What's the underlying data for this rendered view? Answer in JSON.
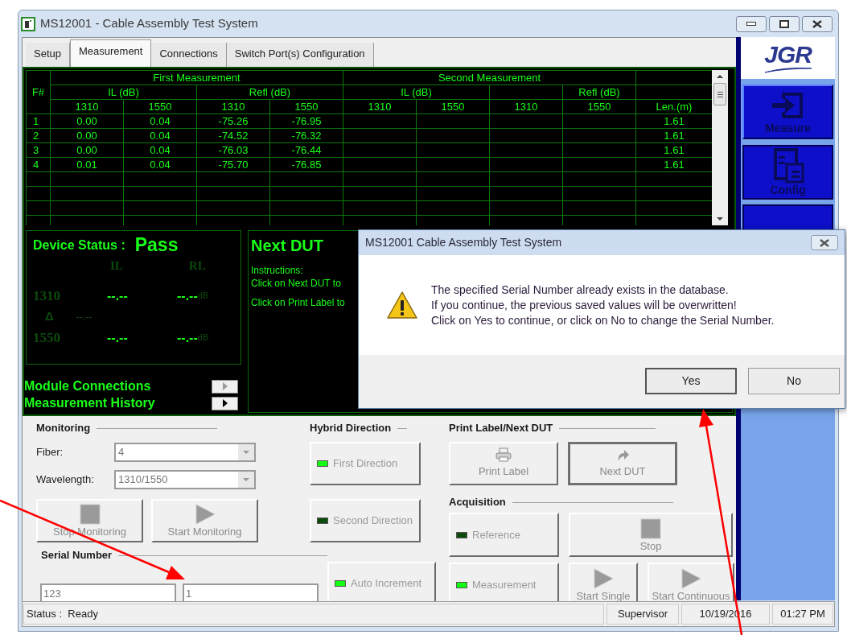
{
  "window": {
    "title": "MS12001 - Cable Assembly Test System"
  },
  "tabs": [
    {
      "label": "Setup",
      "selected": false
    },
    {
      "label": "Measurement",
      "selected": true
    },
    {
      "label": "Connections",
      "selected": false
    },
    {
      "label": "Switch Port(s) Configuration",
      "selected": false
    }
  ],
  "sidebar": {
    "logo": "JGR",
    "items": [
      {
        "label": "Measure",
        "selected": true
      },
      {
        "label": "Config",
        "selected": false
      }
    ]
  },
  "table": {
    "fiber_header": "F#",
    "groups": [
      {
        "title": "First Measurement",
        "il": "IL (dB)",
        "refl": "Refl (dB)"
      },
      {
        "title": "Second Measurement",
        "il": "IL (dB)",
        "refl": "Refl (dB)"
      }
    ],
    "columns": [
      "1310",
      "1550",
      "1310",
      "1550",
      "1310",
      "1550",
      "1310",
      "1550"
    ],
    "length_header": "Len.(m)",
    "rows": [
      {
        "fiber": "1",
        "first": [
          "0.00",
          "0.04",
          "-75.26",
          "-76.95"
        ],
        "length": "1.61"
      },
      {
        "fiber": "2",
        "first": [
          "0.00",
          "0.04",
          "-74.52",
          "-76.32"
        ],
        "length": "1.61"
      },
      {
        "fiber": "3",
        "first": [
          "0.00",
          "0.04",
          "-76.03",
          "-76.44"
        ],
        "length": "1.61"
      },
      {
        "fiber": "4",
        "first": [
          "0.01",
          "0.04",
          "-75.70",
          "-76.85"
        ],
        "length": "1.61"
      }
    ]
  },
  "device_status": {
    "label": "Device Status :",
    "result": "Pass",
    "columns": [
      "IL",
      "RL"
    ],
    "rows": [
      {
        "wavelength": "1310",
        "il": "--.--",
        "rl": "--.--",
        "unit": "dB"
      },
      {
        "wavelength": "1550",
        "il": "--.--",
        "rl": "--.--",
        "unit": "dB"
      }
    ],
    "delta": {
      "symbol": "Δ",
      "value": "--.--"
    }
  },
  "links": [
    {
      "label": "Module Connections",
      "disabled": true
    },
    {
      "label": "Measurement History",
      "disabled": false
    }
  ],
  "next_dut": {
    "title": "Next DUT",
    "paragraphs": [
      [
        "Instructions:",
        "Click on Next DUT to"
      ],
      [
        "Click on Print Label to"
      ]
    ]
  },
  "monitoring": {
    "title": "Monitoring",
    "fiber": {
      "label": "Fiber:",
      "value": "4"
    },
    "wavelength": {
      "label": "Wavelength:",
      "value": "1310/1550"
    },
    "buttons": [
      {
        "label": "Stop Monitoring"
      },
      {
        "label": "Start Monitoring"
      }
    ]
  },
  "serial_number": {
    "title": "Serial Number",
    "fields": [
      "123",
      "1"
    ],
    "auto_increment": {
      "label": "Auto Increment",
      "lit": true
    }
  },
  "hybrid_direction": {
    "title": "Hybrid Direction",
    "buttons": [
      {
        "label": "First Direction",
        "lit": true
      },
      {
        "label": "Second Direction",
        "lit": false
      }
    ]
  },
  "print_label": {
    "title": "Print Label/Next DUT",
    "buttons": [
      {
        "label": "Print Label",
        "default": false
      },
      {
        "label": "Next DUT",
        "default": true
      }
    ]
  },
  "acquisition": {
    "title": "Acquisition",
    "modes": [
      {
        "label": "Reference",
        "lit": false
      },
      {
        "label": "Measurement",
        "lit": true
      }
    ],
    "buttons": [
      {
        "label": "Stop"
      },
      {
        "label": "Start Single"
      },
      {
        "label": "Start Continuous"
      }
    ]
  },
  "status_bar": {
    "status": "Status :  Ready",
    "user": "Supervisor",
    "date": "10/19/2016",
    "time": "01:27 PM"
  },
  "dialog": {
    "title": "MS12001 Cable Assembly Test System",
    "message": [
      "The specified Serial Number already exists in the database.",
      "If you continue, the previous saved values will be overwritten!",
      "Click on Yes to continue, or click on No to change the Serial Number."
    ],
    "buttons": [
      {
        "label": "Yes",
        "default": true
      },
      {
        "label": "No",
        "default": false
      }
    ]
  }
}
